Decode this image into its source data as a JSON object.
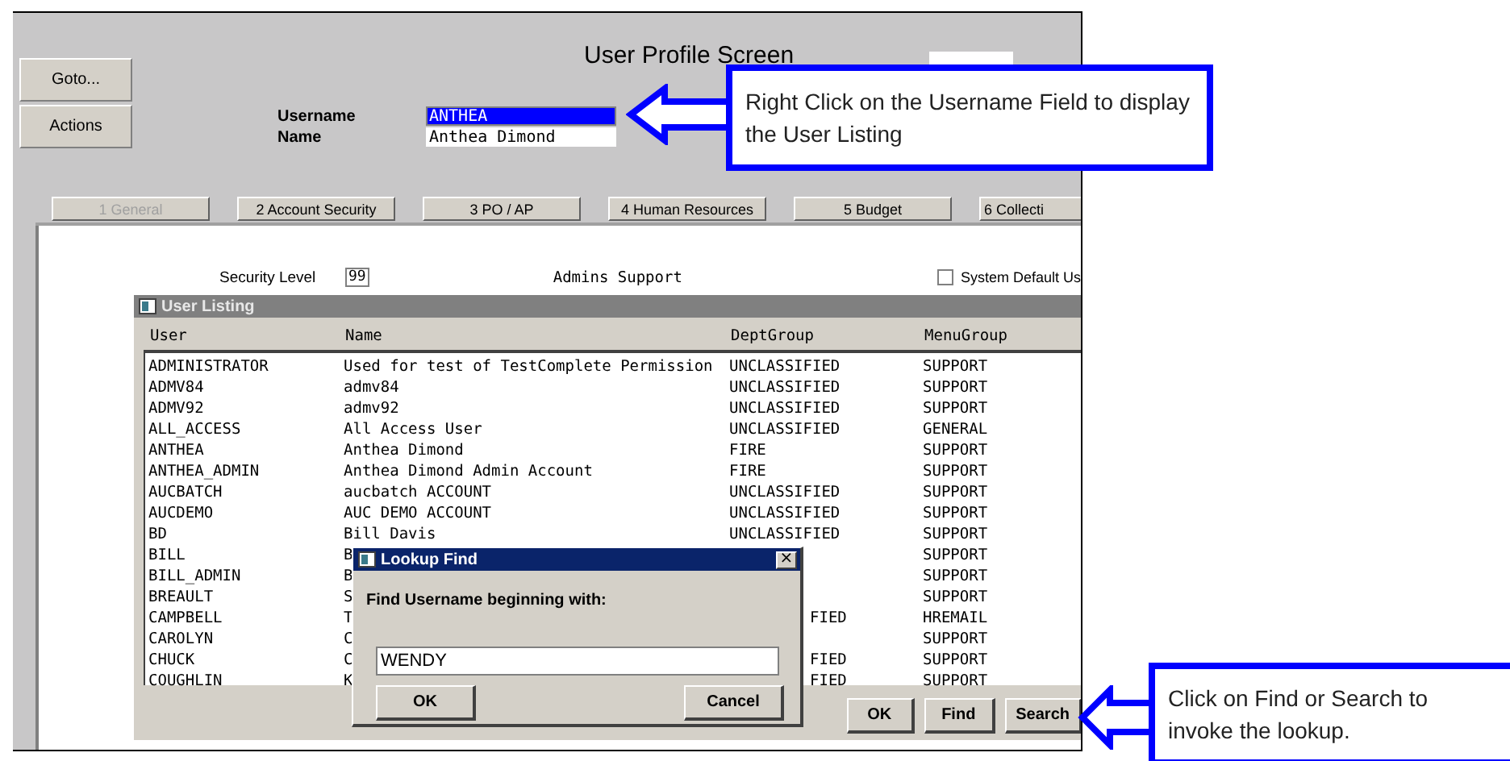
{
  "screen": {
    "title": "User Profile Screen",
    "side_buttons": [
      "Goto...",
      "Actions"
    ],
    "fields": [
      {
        "label": "Username",
        "value": "ANTHEA",
        "selected": true
      },
      {
        "label": "Name",
        "value": "Anthea Dimond",
        "selected": false
      }
    ],
    "tabs": [
      {
        "label": "1 General",
        "selected": true
      },
      {
        "label": "2 Account Security",
        "selected": false
      },
      {
        "label": "3 PO / AP",
        "selected": false
      },
      {
        "label": "4 Human Resources",
        "selected": false
      },
      {
        "label": "5 Budget",
        "selected": false
      },
      {
        "label": "6 Collecti",
        "selected": false
      }
    ],
    "security_level": {
      "label": "Security Level",
      "value": "99",
      "group": "Admins Support"
    },
    "system_default": {
      "label": "System Default Us",
      "checked": false
    }
  },
  "user_listing": {
    "title": "User Listing",
    "columns": [
      "User",
      "Name",
      "DeptGroup",
      "MenuGroup"
    ],
    "rows": [
      {
        "user": "ADMINISTRATOR",
        "name": "Used for test of TestComplete Permission",
        "dept": "UNCLASSIFIED",
        "menu": "SUPPORT",
        "kind": "full"
      },
      {
        "user": "ADMV84",
        "name": "admv84",
        "dept": "UNCLASSIFIED",
        "menu": "SUPPORT",
        "kind": "full"
      },
      {
        "user": "ADMV92",
        "name": "admv92",
        "dept": "UNCLASSIFIED",
        "menu": "SUPPORT",
        "kind": "full"
      },
      {
        "user": "ALL_ACCESS",
        "name": "All Access User",
        "dept": "UNCLASSIFIED",
        "menu": "GENERAL",
        "kind": "full"
      },
      {
        "user": "ANTHEA",
        "name": "Anthea Dimond",
        "dept": "FIRE",
        "menu": "SUPPORT",
        "kind": "full"
      },
      {
        "user": "ANTHEA_ADMIN",
        "name": "Anthea Dimond Admin Account",
        "dept": "FIRE",
        "menu": "SUPPORT",
        "kind": "full"
      },
      {
        "user": "AUCBATCH",
        "name": "aucbatch ACCOUNT",
        "dept": "UNCLASSIFIED",
        "menu": "SUPPORT",
        "kind": "full"
      },
      {
        "user": "AUCDEMO",
        "name": "AUC DEMO ACCOUNT",
        "dept": "UNCLASSIFIED",
        "menu": "SUPPORT",
        "kind": "full"
      },
      {
        "user": "BD",
        "name": "Bill Davis",
        "dept": "UNCLASSIFIED",
        "menu": "SUPPORT",
        "kind": "full"
      },
      {
        "user": "BILL",
        "name": "B",
        "menu": "SUPPORT",
        "kind": "covered"
      },
      {
        "user": "BILL_ADMIN",
        "name": "B",
        "menu": "SUPPORT",
        "kind": "covered"
      },
      {
        "user": "BREAULT",
        "name": "S",
        "menu": "SUPPORT",
        "kind": "covered"
      },
      {
        "user": "CAMPBELL",
        "name": "T",
        "dept": "FIED",
        "menu": "HREMAIL",
        "kind": "covered"
      },
      {
        "user": "CAROLYN",
        "name": "C",
        "menu": "SUPPORT",
        "kind": "covered"
      },
      {
        "user": "CHUCK",
        "name": "C",
        "dept": "FIED",
        "menu": "SUPPORT",
        "kind": "covered"
      },
      {
        "user": "COUGHLIN",
        "name": "K",
        "dept": "FIED",
        "menu": "SUPPORT",
        "kind": "covered"
      }
    ],
    "buttons": [
      "OK",
      "Find",
      "Search"
    ]
  },
  "lookup_find": {
    "title": "Lookup Find",
    "close": "×",
    "prompt": "Find Username beginning with:",
    "value": "WENDY",
    "buttons": [
      "OK",
      "Cancel"
    ]
  },
  "callouts": [
    {
      "text": "Right Click on the Username Field to display the User Listing"
    },
    {
      "text": "Click on Find or Search to invoke the lookup."
    }
  ]
}
